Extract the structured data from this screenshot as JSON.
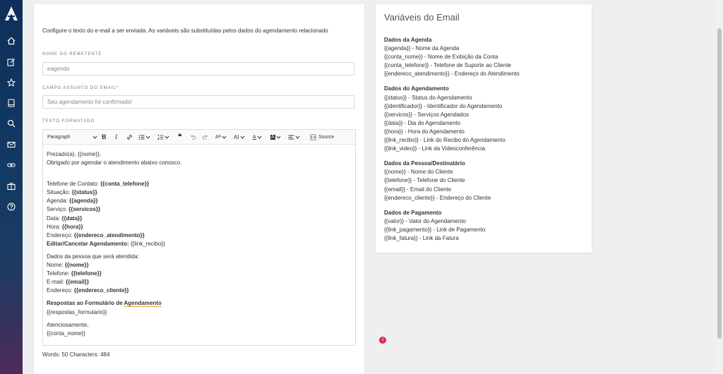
{
  "form": {
    "intro": "Configure o texto do e-mail a ser enviada. As variáveis são substituídas pelos dados do agendamento relacionado",
    "sender_label": "NOME DO REMETENTE",
    "sender_value": "eagenda",
    "subject_label": "CAMPO ASSUNTO DO EMAIL*",
    "subject_value": "Seu agendamento foi confirmado!",
    "body_label": "TEXTO FORMATADO"
  },
  "toolbar": {
    "paragraph": "Paragraph",
    "source": "Source"
  },
  "editor_lines": [
    {
      "parts": [
        {
          "t": "Prezado(a), {{nome}},"
        }
      ]
    },
    {
      "parts": [
        {
          "t": "Obrigado por agendar o atendimento abaixo conosco."
        }
      ]
    },
    {
      "gap": "big"
    },
    {
      "parts": [
        {
          "t": "Telefone de Contato: "
        },
        {
          "t": "{{conta_telefone}}",
          "b": true
        }
      ]
    },
    {
      "parts": [
        {
          "t": "Situação: "
        },
        {
          "t": "{{status}}",
          "b": true
        }
      ]
    },
    {
      "parts": [
        {
          "t": "Agenda: "
        },
        {
          "t": "{{agenda}}",
          "b": true
        }
      ]
    },
    {
      "parts": [
        {
          "t": "Serviço: "
        },
        {
          "t": "{{servicos}}",
          "b": true
        }
      ]
    },
    {
      "parts": [
        {
          "t": "Data: "
        },
        {
          "t": "{{data}}",
          "b": true
        }
      ]
    },
    {
      "parts": [
        {
          "t": "Hora: "
        },
        {
          "t": "{{hora}}",
          "b": true
        }
      ]
    },
    {
      "parts": [
        {
          "t": "Endereço: "
        },
        {
          "t": "{{endereco_atendimento}}",
          "b": true
        }
      ]
    },
    {
      "parts": [
        {
          "t": "Editar/Cancelar Agendamento: ",
          "b": true
        },
        {
          "t": "{{link_recibo}}"
        }
      ]
    },
    {
      "gap": "small"
    },
    {
      "parts": [
        {
          "t": "Dados da pessoa que será atendida:"
        }
      ]
    },
    {
      "parts": [
        {
          "t": "Nome: "
        },
        {
          "t": "{{nome}}",
          "b": true
        }
      ]
    },
    {
      "parts": [
        {
          "t": "Telefone: "
        },
        {
          "t": "{{telefone}}",
          "b": true
        }
      ]
    },
    {
      "parts": [
        {
          "t": "E-mail: "
        },
        {
          "t": "{{email}}",
          "b": true
        }
      ]
    },
    {
      "parts": [
        {
          "t": "Endereço: "
        },
        {
          "t": "{{endereco_cliente}}",
          "b": true
        }
      ]
    },
    {
      "gap": "small"
    },
    {
      "parts": [
        {
          "t": "Respostas ao Formulário de ",
          "b": true
        },
        {
          "t": "Agendamento",
          "b": true,
          "u": true
        }
      ]
    },
    {
      "parts": [
        {
          "t": "{{respostas_formulario}}"
        }
      ]
    },
    {
      "gap": "small"
    },
    {
      "parts": [
        {
          "t": "Atenciosamente,"
        }
      ]
    },
    {
      "parts": [
        {
          "t": "{{conta_nome}}"
        }
      ]
    }
  ],
  "badge": "1",
  "counts": "Words: 50   Characters: 484",
  "variables": {
    "title": "Variáveis do Email",
    "sections": [
      {
        "heading": "Dados da Agenda",
        "items": [
          "{{agenda}} - Nome da Agenda",
          "{{conta_nome}} - Nome de Exibição da Conta",
          "{{conta_telefone}} - Telefone de Suporte ao Cliente",
          "{{endereco_atendimento}} - Endereço do Atendimento"
        ]
      },
      {
        "heading": "Dados do Agendamento",
        "items": [
          "{{status}} - Status do Agendamento",
          "{{identificador}} - Identificador do Agendamento",
          "{{servicos}} - Serviços Agendados",
          "{{data}} - Dia do Agendamento",
          "{{hora}} - Hora do Agendamento",
          "{{link_recibo}} - Link do Recibo do Agendamento",
          "{{link_video}} - Link da Videoconferência"
        ]
      },
      {
        "heading": "Dados da Pessoa/Destinatário",
        "items": [
          "{{nome}} - Nome do Cliente",
          "{{telefone}} - Telefone do Cliente",
          "{{email}} - Email do Cliente",
          "{{endereco_cliente}} - Endereço do Cliente"
        ]
      },
      {
        "heading": "Dados de Pagamento",
        "items": [
          "{{valor}} - Valor do Agendamento",
          "{{link_pagamento}} - Link de Pagamento",
          "{{link_fatura}} - Link da Fatura"
        ]
      }
    ]
  },
  "nav_icons": [
    "home-icon",
    "edit-icon",
    "star-icon",
    "book-icon",
    "search-icon",
    "mail-icon",
    "link-icon",
    "briefcase-icon",
    "help-icon"
  ]
}
